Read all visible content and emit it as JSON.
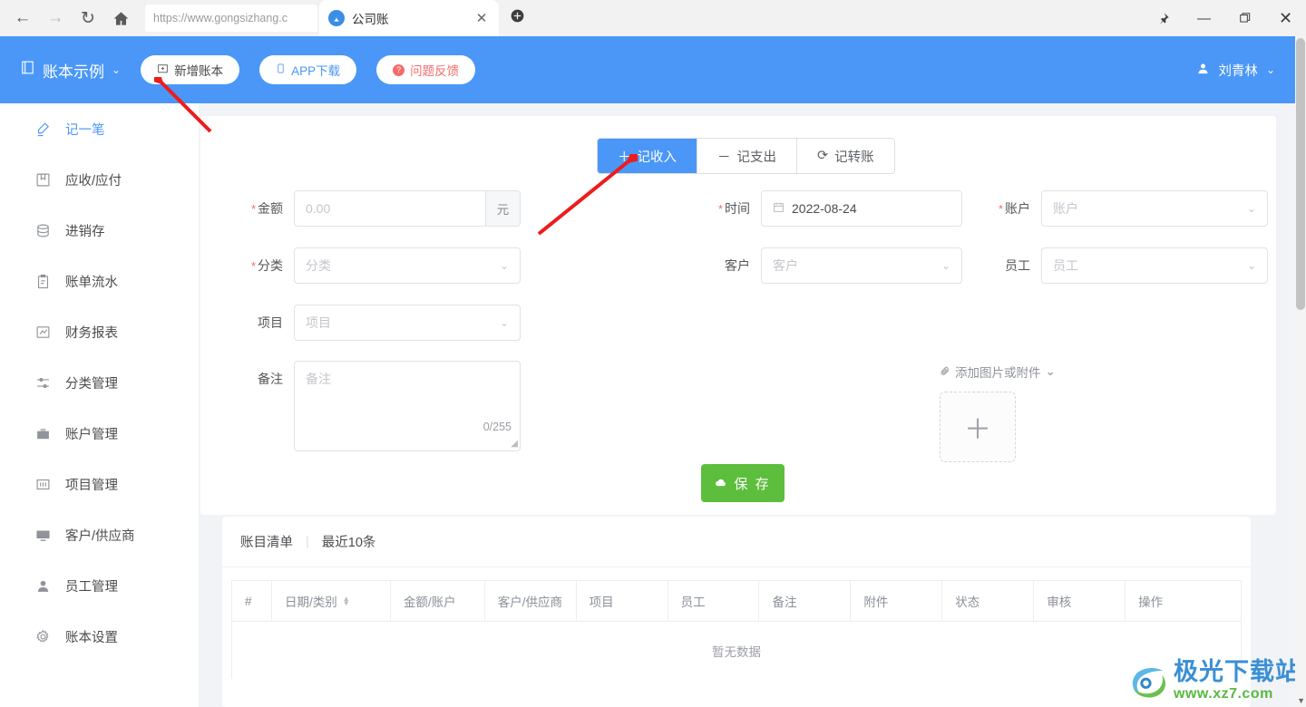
{
  "browser": {
    "url": "https://www.gongsizhang.c",
    "back_icon": "back-arrow-icon",
    "forward_icon": "forward-arrow-icon",
    "reload_icon": "reload-icon",
    "home_icon": "home-icon",
    "tab_title": "公司账",
    "tab_close": "✕",
    "new_tab": "＋",
    "pin": "📌",
    "minimize": "—",
    "maximize": "❐",
    "close": "✕"
  },
  "header": {
    "ledger_name": "账本示例",
    "ledger_caret": "⌄",
    "buttons": [
      {
        "label": "新增账本",
        "icon": "add-book-icon"
      },
      {
        "label": "APP下载",
        "icon": "mobile-icon"
      },
      {
        "label": "问题反馈",
        "icon": "question-badge-icon"
      }
    ],
    "user_name": "刘青林",
    "user_caret": "⌄",
    "bg_color": "#4a97f7"
  },
  "sidebar": {
    "items": [
      {
        "label": "记一笔",
        "icon": "pen-icon",
        "active": true
      },
      {
        "label": "应收/应付",
        "icon": "book-icon",
        "active": false
      },
      {
        "label": "进销存",
        "icon": "database-icon",
        "active": false
      },
      {
        "label": "账单流水",
        "icon": "clipboard-icon",
        "active": false
      },
      {
        "label": "财务报表",
        "icon": "chart-icon",
        "active": false
      },
      {
        "label": "分类管理",
        "icon": "sliders-icon",
        "active": false
      },
      {
        "label": "账户管理",
        "icon": "wallet-icon",
        "active": false
      },
      {
        "label": "项目管理",
        "icon": "project-icon",
        "active": false
      },
      {
        "label": "客户/供应商",
        "icon": "monitor-icon",
        "active": false
      },
      {
        "label": "员工管理",
        "icon": "user-icon",
        "active": false
      },
      {
        "label": "账本设置",
        "icon": "gear-icon",
        "active": false
      }
    ]
  },
  "form": {
    "tabs": [
      {
        "label": "记收入",
        "icon": "＋",
        "selected": true
      },
      {
        "label": "记支出",
        "icon": "－",
        "selected": false
      },
      {
        "label": "记转账",
        "icon": "⟳",
        "selected": false
      }
    ],
    "amount": {
      "label": "金额",
      "placeholder": "0.00",
      "value": "",
      "suffix": "元",
      "required": true
    },
    "time": {
      "label": "时间",
      "value": "2022-08-24",
      "icon": "calendar-icon",
      "required": true
    },
    "account": {
      "label": "账户",
      "placeholder": "账户",
      "value": "",
      "required": true
    },
    "category": {
      "label": "分类",
      "placeholder": "分类",
      "value": "",
      "required": true
    },
    "customer": {
      "label": "客户",
      "placeholder": "客户",
      "value": "",
      "required": false
    },
    "staff": {
      "label": "员工",
      "placeholder": "员工",
      "value": "",
      "required": false
    },
    "project": {
      "label": "项目",
      "placeholder": "项目",
      "value": "",
      "required": false
    },
    "remark": {
      "label": "备注",
      "placeholder": "备注",
      "value": "",
      "counter": "0/255"
    },
    "attachment": {
      "label": "添加图片或附件",
      "icon": "paperclip-icon",
      "caret": "⌄",
      "add": "＋"
    },
    "save": {
      "label": "保 存",
      "icon": "cloud-icon",
      "color": "#5cbe3c"
    }
  },
  "table": {
    "title": "账目清单",
    "divider": "|",
    "subtitle": "最近10条",
    "columns": [
      "#",
      "日期/类别",
      "金额/账户",
      "客户/供应商",
      "项目",
      "员工",
      "备注",
      "附件",
      "状态",
      "审核",
      "操作"
    ],
    "sortable_column": "日期/类别",
    "empty_text": "暂无数据",
    "rows": []
  },
  "watermark": {
    "title": "极光下载站",
    "url": "www.xz7.com"
  }
}
